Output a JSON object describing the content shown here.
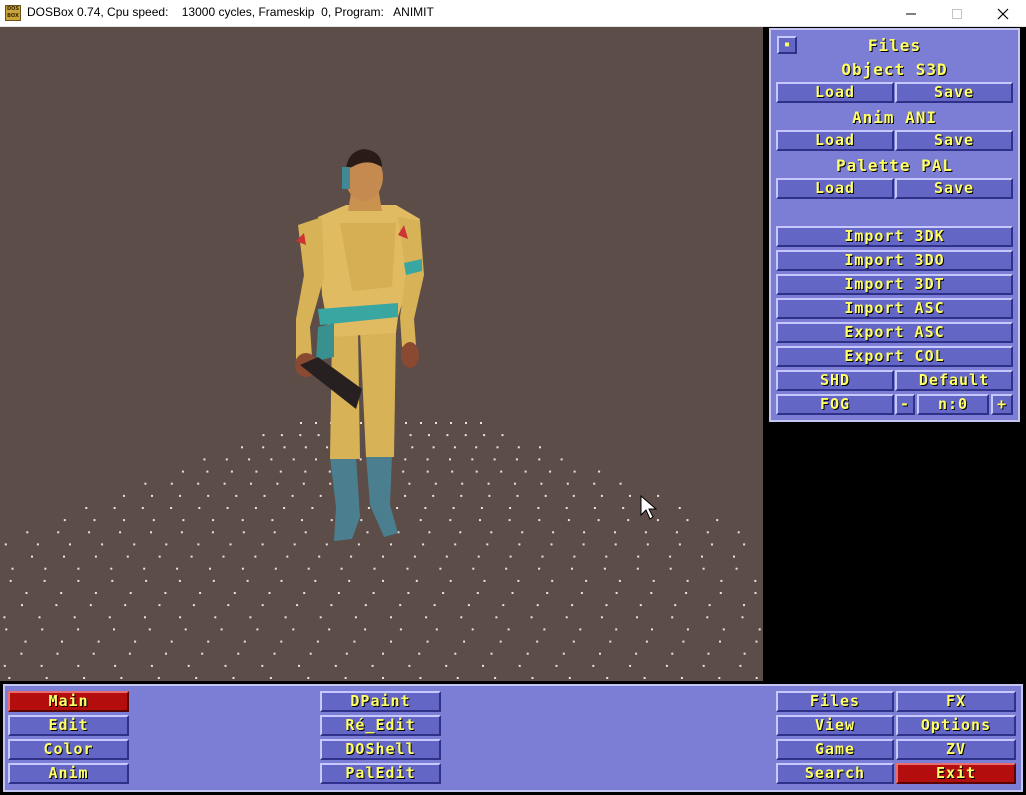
{
  "window": {
    "title": "DOSBox 0.74, Cpu speed:    13000 cycles, Frameskip  0, Program:   ANIMIT",
    "icon_text": "DOS BOX",
    "minimize_icon": "minimize-icon",
    "maximize_icon": "maximize-icon",
    "close_icon": "close-icon"
  },
  "files_panel": {
    "small_button_icon": "square-dot-icon",
    "title": "Files",
    "object_heading": "Object S3D",
    "object_load": "Load",
    "object_save": "Save",
    "anim_heading": "Anim ANI",
    "anim_load": "Load",
    "anim_save": "Save",
    "palette_heading": "Palette PAL",
    "palette_load": "Load",
    "palette_save": "Save",
    "import_3dk": "Import 3DK",
    "import_3do": "Import 3DO",
    "import_3dt": "Import 3DT",
    "import_asc": "Import ASC",
    "export_asc": "Export ASC",
    "export_col": "Export COL",
    "shd": "SHD",
    "default": "Default",
    "fog": "FOG",
    "fog_minus": "-",
    "fog_value": "n:0",
    "fog_plus": "+"
  },
  "bottom_menu": {
    "main": "Main",
    "edit": "Edit",
    "color": "Color",
    "anim": "Anim",
    "dpaint": "DPaint",
    "re_edit": "Ré_Edit",
    "doshell": "DOShell",
    "paledit": "PalEdit",
    "files": "Files",
    "view": "View",
    "game": "Game",
    "search": "Search",
    "fx": "FX",
    "options": "Options",
    "zv": "ZV",
    "exit": "Exit"
  },
  "colors": {
    "panel": "#7c7ed6",
    "button": "#6466c6",
    "button_text": "#ffff66",
    "active_button": "#b40d0d",
    "viewport_bg": "#5c4d48"
  }
}
